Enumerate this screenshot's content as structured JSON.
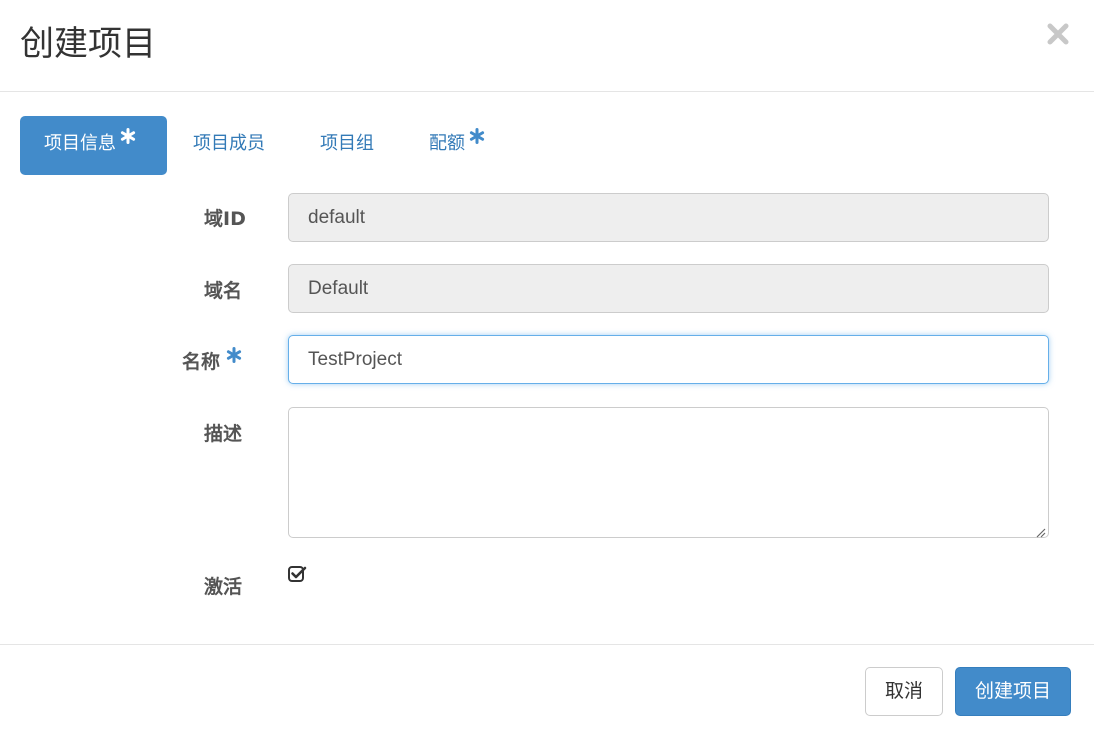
{
  "modal": {
    "title": "创建项目",
    "close_icon": "close-icon"
  },
  "tabs": [
    {
      "label": "项目信息",
      "required": true,
      "active": true
    },
    {
      "label": "项目成员",
      "required": false,
      "active": false
    },
    {
      "label": "项目组",
      "required": false,
      "active": false
    },
    {
      "label": "配额",
      "required": true,
      "active": false
    }
  ],
  "form": {
    "domain_id": {
      "label": "域ID",
      "value": "default",
      "readonly": true
    },
    "domain_name": {
      "label": "域名",
      "value": "Default",
      "readonly": true
    },
    "name": {
      "label": "名称",
      "value": "TestProject",
      "required": true
    },
    "description": {
      "label": "描述",
      "value": ""
    },
    "enabled": {
      "label": "激活",
      "checked": true
    }
  },
  "footer": {
    "cancel_label": "取消",
    "submit_label": "创建项目"
  },
  "colors": {
    "primary": "#428bca",
    "link": "#337ab7",
    "required_star": "#428bca"
  }
}
